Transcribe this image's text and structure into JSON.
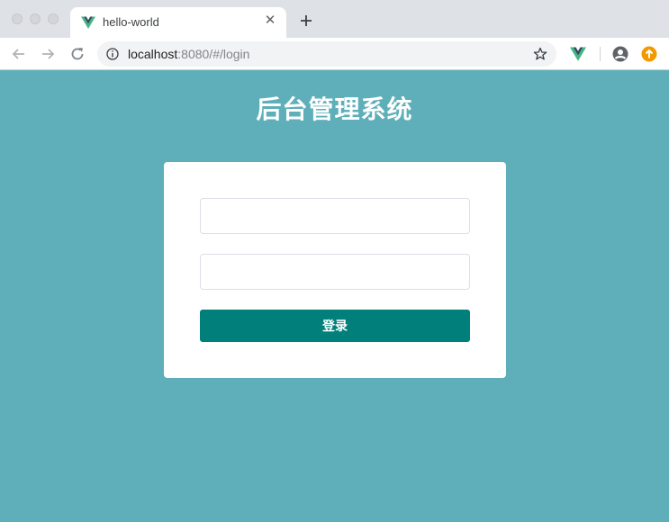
{
  "browser": {
    "tab": {
      "title": "hello-world",
      "favicon": "vue-logo-icon",
      "close_glyph": "✕"
    },
    "address_bar": {
      "host": "localhost",
      "rest": ":8080/#/login"
    },
    "icons": {
      "back": "arrow-left-icon",
      "forward": "arrow-right-icon",
      "reload": "reload-icon",
      "info": "info-icon",
      "bookmark": "star-icon",
      "extension": "vue-devtools-icon",
      "profile": "profile-icon",
      "update": "update-icon",
      "new_tab": "plus-icon"
    }
  },
  "page": {
    "title": "后台管理系统",
    "background_color": "#5eafb9",
    "login_form": {
      "username": {
        "value": "",
        "placeholder": ""
      },
      "password": {
        "value": "",
        "placeholder": ""
      },
      "submit_label": "登录",
      "submit_color": "#007f7b"
    }
  }
}
